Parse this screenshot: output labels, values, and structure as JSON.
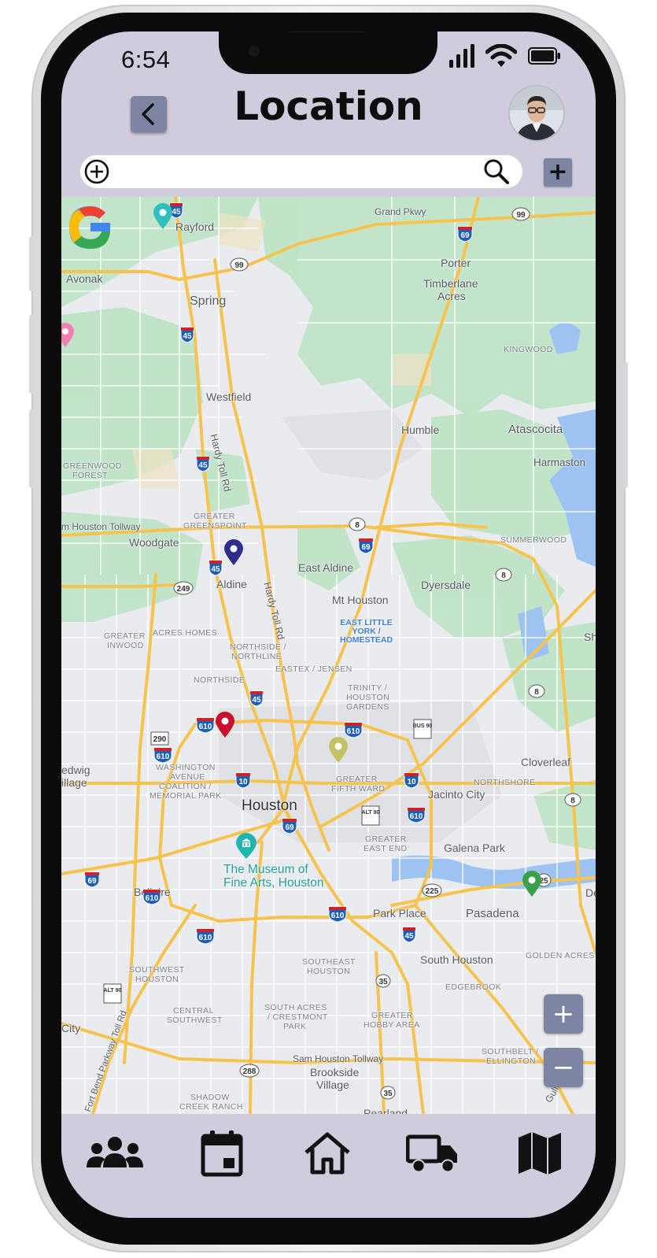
{
  "status": {
    "time": "6:54"
  },
  "header": {
    "title": "Location",
    "back_icon": "chevron-left-icon",
    "avatar": "user-avatar-photo"
  },
  "search": {
    "value": "",
    "placeholder": "",
    "add_icon": "plus-circle-icon",
    "search_icon": "search-icon",
    "add_button_label": "+"
  },
  "colors": {
    "ui_background": "#d0cbdd",
    "button": "#7d85a3",
    "map_road": "#f7c94f",
    "map_park": "#bde3c5",
    "water": "#9cc3f2"
  },
  "map": {
    "provider_logo": "google-logo",
    "labels": {
      "rayford": "Rayford",
      "grand_pkwy": "Grand Pkwy",
      "porter": "Porter",
      "avonak": "Avonak",
      "spring": "Spring",
      "timberlane": "Timberlane",
      "acres": "Acres",
      "kingwood": "KINGWOOD",
      "westfield": "Westfield",
      "hardy_toll_n": "Hardy Toll Rd",
      "humble": "Humble",
      "atascocita": "Atascocita",
      "harmaston": "Harmaston",
      "greenwood": "GREENWOOD",
      "forest": "FOREST",
      "sam_houston_tollway_w": "m Houston Tollway",
      "greater_greenspoint_1": "GREATER",
      "greater_greenspoint_2": "GREENSPOINT",
      "summerwood": "SUMMERWOOD",
      "woodgate": "Woodgate",
      "east_aldine": "East Aldine",
      "aldine": "Aldine",
      "dyersdale": "Dyersdale",
      "hardy_toll_s": "Hardy Toll Rd",
      "mt_houston": "Mt Houston",
      "east_little_york": "EAST LITTLE\nYORK /\nHOMESTEAD",
      "greater_inwood_1": "GREATER",
      "greater_inwood_2": "INWOOD",
      "acres_homes": "ACRES HOMES",
      "sh": "Sh",
      "northside_northline_1": "NORTHSIDE /",
      "northside_northline_2": "NORTHLINE",
      "eastex_jensen": "EASTEX / JENSEN",
      "northside": "NORTHSIDE",
      "trinity_1": "TRINITY /",
      "trinity_2": "HOUSTON",
      "trinity_3": "GARDENS",
      "edgewig": "edwig",
      "illage": "illage",
      "washington_1": "WASHINGTON",
      "washington_2": "AVENUE",
      "washington_3": "COALITION /",
      "washington_4": "MEMORIAL PARK",
      "cloverleaf": "Cloverleaf",
      "greater_fifth_1": "GREATER",
      "greater_fifth_2": "FIFTH WARD",
      "northshore": "NORTHSHORE",
      "jacinto_city": "Jacinto City",
      "houston": "Houston",
      "greater_east_end_1": "GREATER",
      "greater_east_end_2": "EAST END",
      "galena_park": "Galena Park",
      "museum": "The Museum of\nFine Arts, Houston",
      "de": "De",
      "bellaire": "Bellaire",
      "park_place": "Park Place",
      "pasadena": "Pasadena",
      "southwest_houston_1": "SOUTHWEST",
      "southwest_houston_2": "HOUSTON",
      "southeast_houston_1": "SOUTHEAST",
      "southeast_houston_2": "HOUSTON",
      "south_houston": "South Houston",
      "golden_acres": "GOLDEN ACRES",
      "edgebrook": "EDGEBROOK",
      "central_sw_1": "CENTRAL",
      "central_sw_2": "SOUTHWEST",
      "south_acres_1": "SOUTH ACRES",
      "south_acres_2": "/ CRESTMONT",
      "south_acres_3": "PARK",
      "greater_hobby_1": "GREATER",
      "greater_hobby_2": "HOBBY AREA",
      "city": "City",
      "fort_bend_pkwy": "Fort Bend Parkway Toll Rd",
      "sam_houston_tollway_s": "Sam Houston Tollway",
      "southbelt_1": "SOUTHBELT /",
      "southbelt_2": "ELLINGTON",
      "brookside_1": "Brookside",
      "brookside_2": "Village",
      "shadow_creek_1": "SHADOW",
      "shadow_creek_2": "CREEK RANCH",
      "pearland": "Pearland",
      "gulf": "Gulf"
    },
    "shields": [
      "45",
      "69",
      "99",
      "99",
      "45",
      "45",
      "8",
      "69",
      "45",
      "249",
      "8",
      "45",
      "8",
      "610",
      "290",
      "610",
      "610",
      "BUS 90",
      "10",
      "10",
      "610",
      "8",
      "69",
      "ALT 90",
      "69",
      "225",
      "610",
      "25",
      "610",
      "45",
      "610",
      "35",
      "ALT 90",
      "288",
      "35",
      "45"
    ],
    "pins": [
      {
        "name": "teal-pin",
        "color": "#2fbfbf"
      },
      {
        "name": "pink-pin",
        "color": "#f07fb4"
      },
      {
        "name": "navy-pin",
        "color": "#2e2d8a"
      },
      {
        "name": "red-pin",
        "color": "#c8102e"
      },
      {
        "name": "olive-pin",
        "color": "#c3c365"
      },
      {
        "name": "museum-pin",
        "color": "#1fb6b0"
      },
      {
        "name": "green-pin",
        "color": "#3ba04a"
      }
    ],
    "zoom_in_label": "+",
    "zoom_out_label": "−"
  },
  "nav": [
    {
      "name": "nav-people",
      "icon": "people-group-icon"
    },
    {
      "name": "nav-calendar",
      "icon": "calendar-icon"
    },
    {
      "name": "nav-home",
      "icon": "home-icon"
    },
    {
      "name": "nav-delivery",
      "icon": "truck-icon"
    },
    {
      "name": "nav-map",
      "icon": "map-icon"
    }
  ]
}
